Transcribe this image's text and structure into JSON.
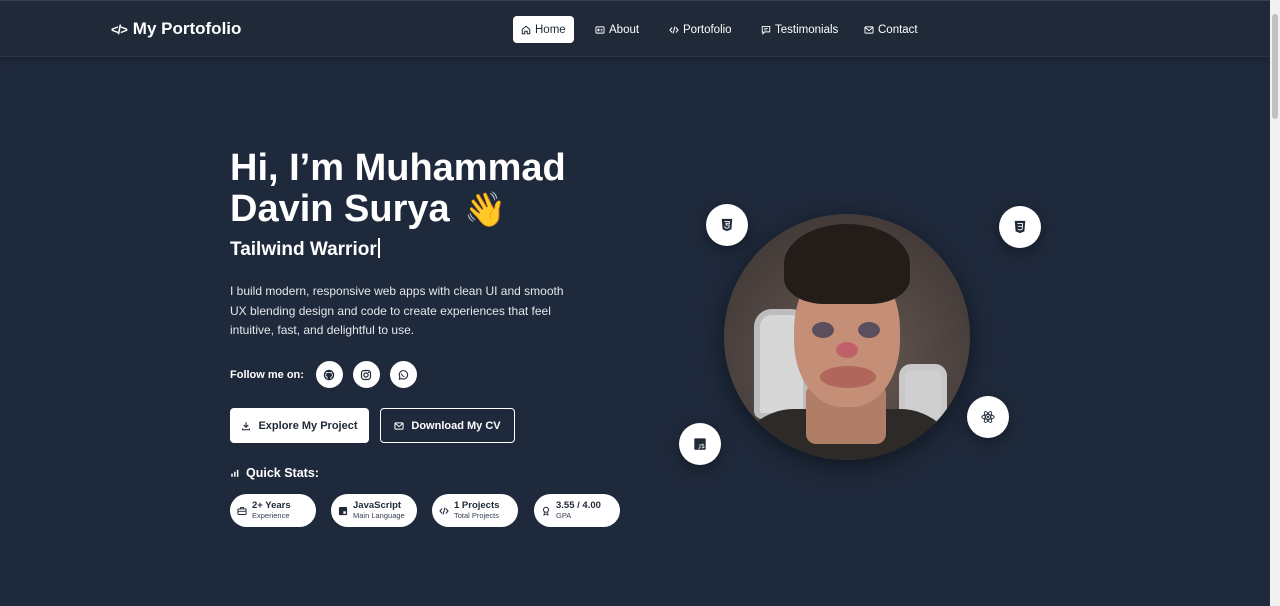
{
  "header": {
    "brand": "My Portofolio",
    "nav": [
      {
        "label": "Home",
        "icon": "home-icon",
        "active": true
      },
      {
        "label": "About",
        "icon": "id-card-icon",
        "active": false
      },
      {
        "label": "Portofolio",
        "icon": "code-icon",
        "active": false
      },
      {
        "label": "Testimonials",
        "icon": "message-icon",
        "active": false
      },
      {
        "label": "Contact",
        "icon": "mail-icon",
        "active": false
      }
    ]
  },
  "hero": {
    "title": "Hi, I’m Muhammad Davin Surya",
    "wave": "👋",
    "role": "Tailwind Warrior",
    "description": "I build modern, responsive web apps with clean UI and smooth UX blending design and code to create experiences that feel intuitive, fast, and delightful to use.",
    "follow_label": "Follow me on:",
    "socials": [
      "github-icon",
      "instagram-icon",
      "whatsapp-icon"
    ],
    "primary_button": "Explore My Project",
    "secondary_button": "Download My CV"
  },
  "stats": {
    "title": "Quick Stats:",
    "items": [
      {
        "value": "2+ Years",
        "label": "Experience",
        "icon": "briefcase-icon"
      },
      {
        "value": "JavaScript",
        "label": "Main Language",
        "icon": "js-icon"
      },
      {
        "value": "1 Projects",
        "label": "Total Projects",
        "icon": "code-icon"
      },
      {
        "value": "3.55 / 4.00",
        "label": "GPA",
        "icon": "award-icon"
      }
    ]
  },
  "tech_icons": [
    "html5-icon",
    "css3-icon",
    "react-icon",
    "javascript-icon"
  ],
  "colors": {
    "background": "#1e293b",
    "header": "#1f2937",
    "text": "#ffffff",
    "card": "#ffffff"
  }
}
